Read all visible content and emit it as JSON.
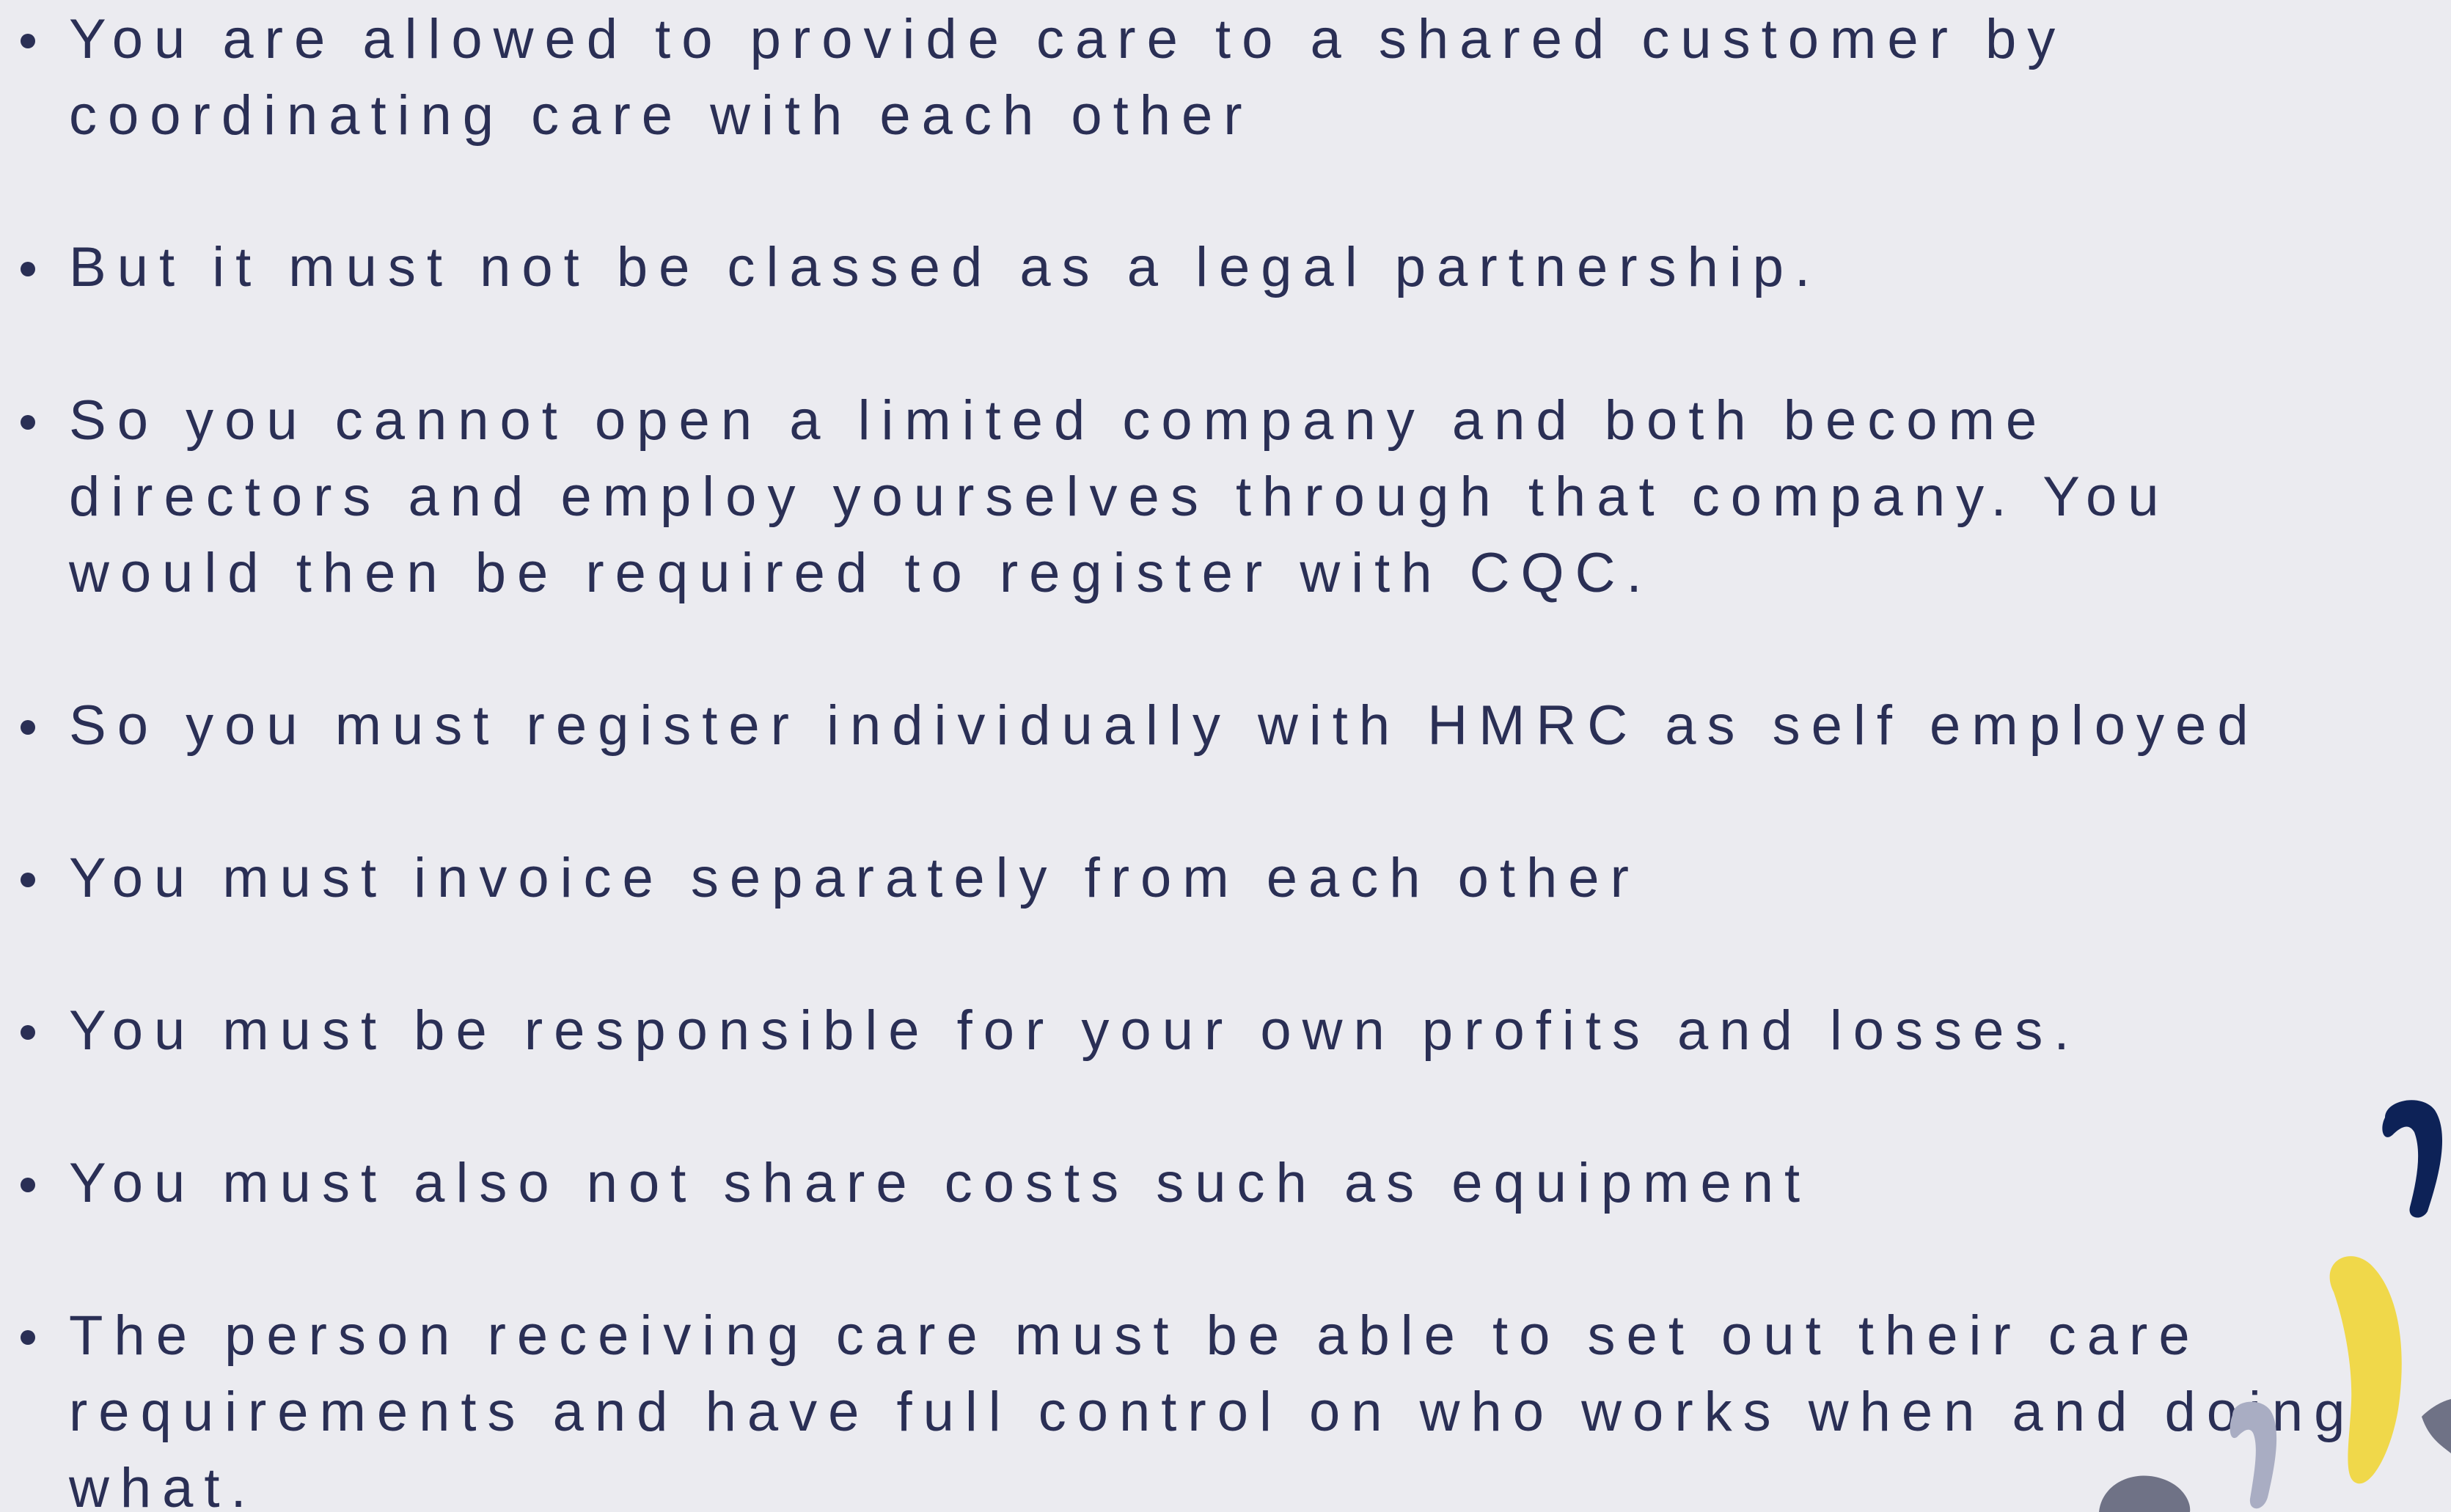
{
  "bullets": [
    {
      "lines": [
        "You are allowed to provide care to a shared customer by",
        "coordinating care with each other"
      ]
    },
    {
      "lines": [
        "But it must not be classed as a legal partnership."
      ]
    },
    {
      "lines": [
        "So you cannot open a limited company and both become",
        "directors and employ yourselves through that company. You",
        "would then be required to register with CQC."
      ]
    },
    {
      "lines": [
        "So you must register individually with HMRC as self employed"
      ]
    },
    {
      "lines": [
        "You must invoice separately from each other"
      ]
    },
    {
      "lines": [
        "You must be responsible for your own profits and losses."
      ]
    },
    {
      "lines": [
        "You must also not share costs such as equipment"
      ]
    },
    {
      "lines": [
        "The person receiving care must be able to set out their care",
        "requirements and have full control on who works when and doing",
        "what."
      ]
    }
  ],
  "colors": {
    "background": "#ebebf0",
    "text": "#2a2f55",
    "deco_navy": "#0d2257",
    "deco_yellow": "#f0d84a",
    "deco_light_gray": "#a9adc3",
    "deco_dark_gray": "#6f7286"
  }
}
